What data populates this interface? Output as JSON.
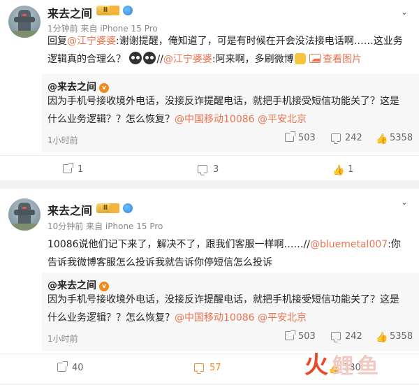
{
  "posts": [
    {
      "author": "来去之间",
      "vip_badge": "Ⅱ",
      "time": "1分钟前",
      "source": "来自 iPhone 15 Pro",
      "text_parts": {
        "p1": "回复",
        "m1": "@江宁婆婆",
        "p2": ":谢谢提醒，俺知道了，可是有时候在开会没法接电话啊……这业务逻辑真的合理么？",
        "p3": "//",
        "m2": "@江宁婆婆",
        "p4": ":阿来啊，多刷微博",
        "view_image": "查看图片"
      },
      "quote": {
        "author": "@来去之间",
        "v": "v",
        "text": "因为手机号接收境外电话，没接反诈提醒电话，就把手机接受短信功能关了？这是什么业务逻辑？？怎么恢复？",
        "mention1": "@中国移动10086",
        "mention2": "@平安北京",
        "time": "1小时前",
        "reposts": "503",
        "comments": "242",
        "likes": "5358"
      },
      "footer": {
        "reposts": "1",
        "comments": "3",
        "likes": "1"
      }
    },
    {
      "author": "来去之间",
      "vip_badge": "Ⅱ",
      "time": "10分钟前",
      "source": "来自 iPhone 15 Pro",
      "text_parts": {
        "p1": "10086说他们记下来了，解决不了，跟我们客服一样啊……//",
        "m1": "@bluemetal007",
        "p2": ":你告诉我微博客服怎么投诉我就告诉你停短信怎么投诉"
      },
      "quote": {
        "author": "@来去之间",
        "v": "v",
        "text": "因为手机号接收境外电话，没接反诈提醒电话，就把手机接受短信功能关了？这是什么业务逻辑？？怎么恢复？",
        "mention1": "@中国移动10086",
        "mention2": "@平安北京",
        "time": "1小时前",
        "reposts": "503",
        "comments": "242",
        "likes": "5358"
      },
      "footer": {
        "reposts": "40",
        "comments": "57",
        "likes": "130"
      }
    }
  ],
  "watermark": {
    "char1": "火",
    "rest": "鲤鱼"
  },
  "colors": {
    "mention": "#eb7350",
    "active": "#f08a1f",
    "background": "#f2f2f2"
  },
  "icons": [
    "chevron-down-icon",
    "vip-badge-icon",
    "level-badge-icon",
    "globe-badge-icon",
    "share-icon",
    "comment-icon",
    "like-icon",
    "image-icon",
    "verified-v-icon"
  ]
}
